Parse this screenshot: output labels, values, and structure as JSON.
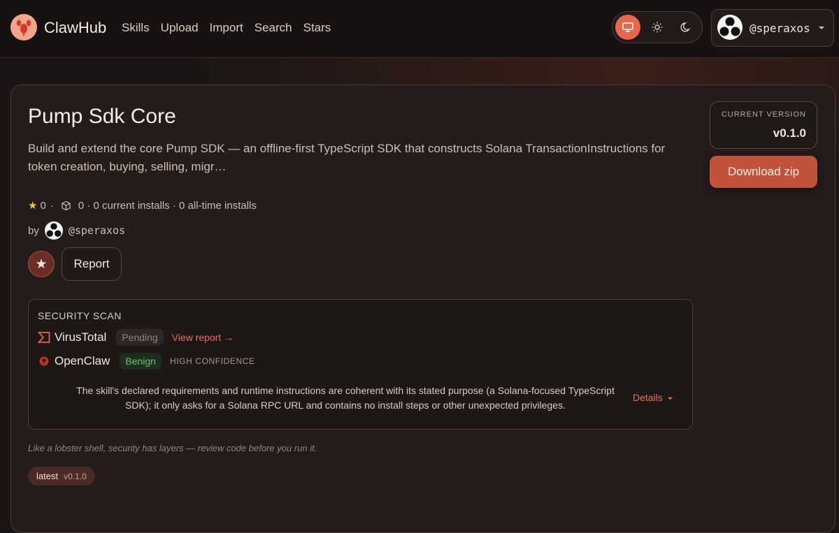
{
  "header": {
    "brand": "ClawHub",
    "nav": [
      "Skills",
      "Upload",
      "Import",
      "Search",
      "Stars"
    ],
    "theme_options": [
      "monitor-icon",
      "sun-icon",
      "moon-icon"
    ],
    "active_theme": "monitor-icon",
    "user": "@speraxos"
  },
  "skill": {
    "title": "Pump Sdk Core",
    "description": "Build and extend the core Pump SDK — an offline-first TypeScript SDK that constructs Solana TransactionInstructions for token creation, buying, selling, migr…",
    "stars": "0",
    "installs_text": "0 · 0 current installs · 0 all-time installs",
    "by_label": "by",
    "author": "@speraxos",
    "star_glyph": "★",
    "report_label": "Report",
    "version_label": "CURRENT VERSION",
    "version": "v0.1.0",
    "download_label": "Download zip"
  },
  "security": {
    "title": "SECURITY SCAN",
    "virustotal": {
      "name": "VirusTotal",
      "status": "Pending",
      "link": "View report →"
    },
    "openclaw": {
      "name": "OpenClaw",
      "status": "Benign",
      "confidence": "HIGH CONFIDENCE"
    },
    "summary": "The skill's declared requirements and runtime instructions are coherent with its stated purpose (a Solana-focused TypeScript SDK); it only asks for a Solana RPC URL and contains no install steps or other unexpected privileges.",
    "details_label": "Details"
  },
  "footer": {
    "tagline": "Like a lobster shell, security has layers — review code before you run it.",
    "tag_name": "latest",
    "tag_version": "v0.1.0"
  },
  "colors": {
    "accent": "#e8674c",
    "download": "#c2523a",
    "benign": "#5fc56a",
    "background": "#1a1514"
  }
}
